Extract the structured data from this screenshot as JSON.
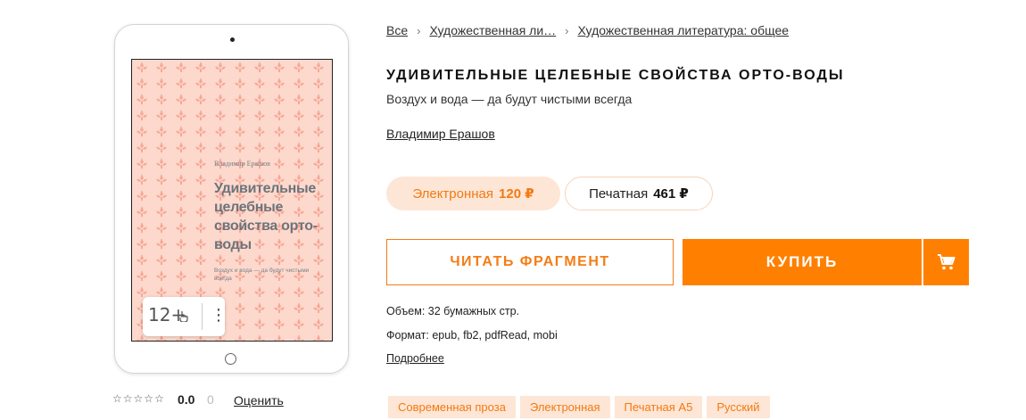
{
  "breadcrumb": {
    "items": [
      "Все",
      "Художественная ли…",
      "Художественная литература: общее"
    ],
    "separator": "›"
  },
  "book": {
    "title": "УДИВИТЕЛЬНЫЕ ЦЕЛЕБНЫЕ СВОЙСТВА ОРТО-ВОДЫ",
    "subtitle": "Воздух и вода — да будут чистыми всегда",
    "author": "Владимир Ерашов"
  },
  "cover": {
    "author": "Владимир Ерашов",
    "title": "Удивительные целебные свойства орто-воды",
    "subtitle": "Воздух и вода — да будут чистыми всегда",
    "age_rating": "12+",
    "menu_icon": "⋮",
    "background_color": "#fcd9cc",
    "pattern_color": "#f6a898",
    "pattern_icon": "fleur-de-lis-icon"
  },
  "rating": {
    "stars": [
      "☆",
      "☆",
      "☆",
      "☆",
      "☆"
    ],
    "value": "0.0",
    "count": "0",
    "rate_label": "Оценить"
  },
  "formats": {
    "ebook": {
      "label": "Электронная",
      "price": "120 ₽"
    },
    "print": {
      "label": "Печатная",
      "price": "461 ₽"
    }
  },
  "actions": {
    "read_label": "ЧИТАТЬ ФРАГМЕНТ",
    "buy_label": "КУПИТЬ",
    "cart_icon": "cart-icon"
  },
  "details": {
    "volume": "Объем: 32 бумажных стр.",
    "format": "Формат: epub, fb2, pdfRead, mobi",
    "more_label": "Подробнее"
  },
  "tags": [
    "Современная проза",
    "Электронная",
    "Печатная A5",
    "Русский"
  ],
  "colors": {
    "accent": "#ff8000",
    "accent_text": "#f27a12",
    "accent_light": "#fde6d6"
  }
}
